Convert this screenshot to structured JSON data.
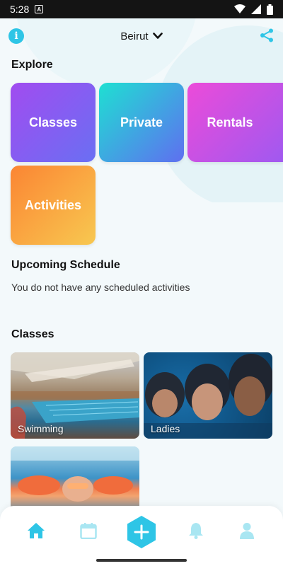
{
  "status_bar": {
    "time": "5:28",
    "app_badge": "A"
  },
  "header": {
    "city": "Beirut"
  },
  "explore": {
    "title": "Explore",
    "tiles": [
      {
        "label": "Classes"
      },
      {
        "label": "Private"
      },
      {
        "label": "Rentals"
      },
      {
        "label": "Activities"
      }
    ]
  },
  "schedule": {
    "title": "Upcoming Schedule",
    "empty_message": "You do not have any scheduled activities"
  },
  "classes": {
    "title": "Classes",
    "items": [
      {
        "label": "Swimming"
      },
      {
        "label": "Ladies"
      },
      {
        "label": ""
      }
    ]
  },
  "colors": {
    "accent": "#2ec5e6",
    "nav_inactive": "#a9e6f2"
  },
  "bottom_nav": {
    "items": [
      "home-icon",
      "calendar-icon",
      "add-icon",
      "bell-icon",
      "profile-icon"
    ]
  }
}
